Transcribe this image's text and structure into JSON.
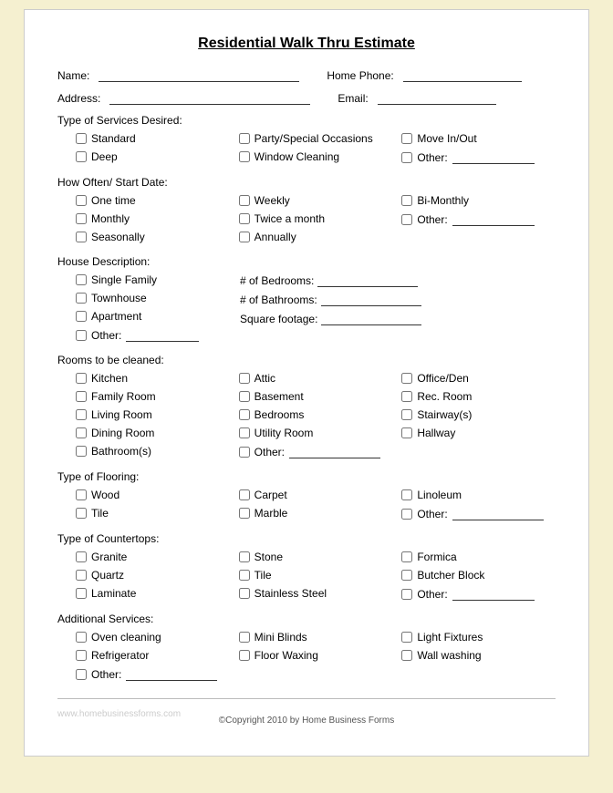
{
  "title": "Residential Walk Thru Estimate",
  "fields": {
    "name_label": "Name:",
    "home_phone_label": "Home Phone:",
    "address_label": "Address:",
    "email_label": "Email:"
  },
  "sections": {
    "services": {
      "label": "Type of Services Desired:",
      "items_col1": [
        "Standard",
        "Deep"
      ],
      "items_col2": [
        "Party/Special Occasions",
        "Window Cleaning"
      ],
      "items_col3_labels": [
        "Move In/Out",
        "Other:"
      ],
      "other_field": true
    },
    "how_often": {
      "label": "How Often/ Start Date:",
      "col1": [
        "One time",
        "Monthly",
        "Seasonally"
      ],
      "col2": [
        "Weekly",
        "Twice a month",
        "Annually"
      ],
      "col3": [
        "Bi-Monthly",
        "Other:"
      ]
    },
    "house_desc": {
      "label": "House Description:",
      "types": [
        "Single Family",
        "Townhouse",
        "Apartment",
        "Other:"
      ],
      "right": [
        {
          "label": "# of Bedrooms:"
        },
        {
          "label": "# of Bathrooms:"
        },
        {
          "label": "Square footage:"
        }
      ]
    },
    "rooms": {
      "label": "Rooms to be cleaned:",
      "col1": [
        "Kitchen",
        "Family Room",
        "Living Room",
        "Dining Room",
        "Bathroom(s)"
      ],
      "col2": [
        "Attic",
        "Basement",
        "Bedrooms",
        "Utility Room",
        "Other:"
      ],
      "col3": [
        "Office/Den",
        "Rec. Room",
        "Stairway(s)",
        "Hallway"
      ]
    },
    "flooring": {
      "label": "Type of Flooring:",
      "col1": [
        "Wood",
        "Tile"
      ],
      "col2": [
        "Carpet",
        "Marble"
      ],
      "col3": [
        "Linoleum",
        "Other:"
      ]
    },
    "countertops": {
      "label": "Type of Countertops:",
      "col1": [
        "Granite",
        "Quartz",
        "Laminate"
      ],
      "col2": [
        "Stone",
        "Tile",
        "Stainless Steel"
      ],
      "col3": [
        "Formica",
        "Butcher Block",
        "Other:"
      ]
    },
    "additional": {
      "label": "Additional Services:",
      "col1": [
        "Oven cleaning",
        "Refrigerator",
        "Other:"
      ],
      "col2": [
        "Mini Blinds",
        "Floor Waxing"
      ],
      "col3": [
        "Light Fixtures",
        "Wall washing"
      ]
    }
  },
  "footer": {
    "copyright": "©Copyright 2010 by Home Business Forms"
  },
  "watermark": "www.homebusinessforms.com"
}
